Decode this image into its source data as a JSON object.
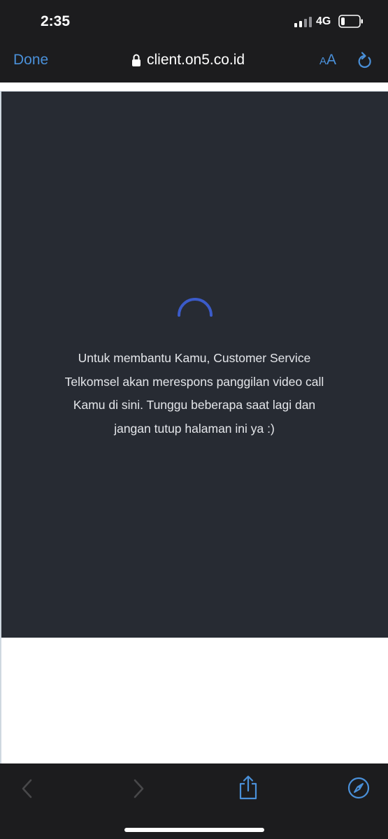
{
  "status_bar": {
    "time": "2:35",
    "network": "4G",
    "icons": [
      "signal-icon",
      "battery-icon"
    ]
  },
  "nav": {
    "done_label": "Done",
    "url": "client.on5.co.id",
    "reader_small": "A",
    "reader_big": "A",
    "icons": [
      "lock-icon",
      "reload-icon"
    ]
  },
  "page": {
    "message": "Untuk membantu Kamu, Customer Service Telkomsel akan merespons panggilan video call Kamu di sini. Tunggu beberapa saat lagi dan jangan tutup halaman ini ya :)",
    "spinner_icon": "loading-spinner-icon"
  },
  "toolbar": {
    "icons": [
      "back-icon",
      "forward-icon",
      "share-icon",
      "compass-icon"
    ]
  },
  "colors": {
    "accent": "#4a90d9",
    "chrome_bg": "#1c1c1e",
    "panel_bg": "#272b33",
    "spinner": "#3b5bc9"
  }
}
